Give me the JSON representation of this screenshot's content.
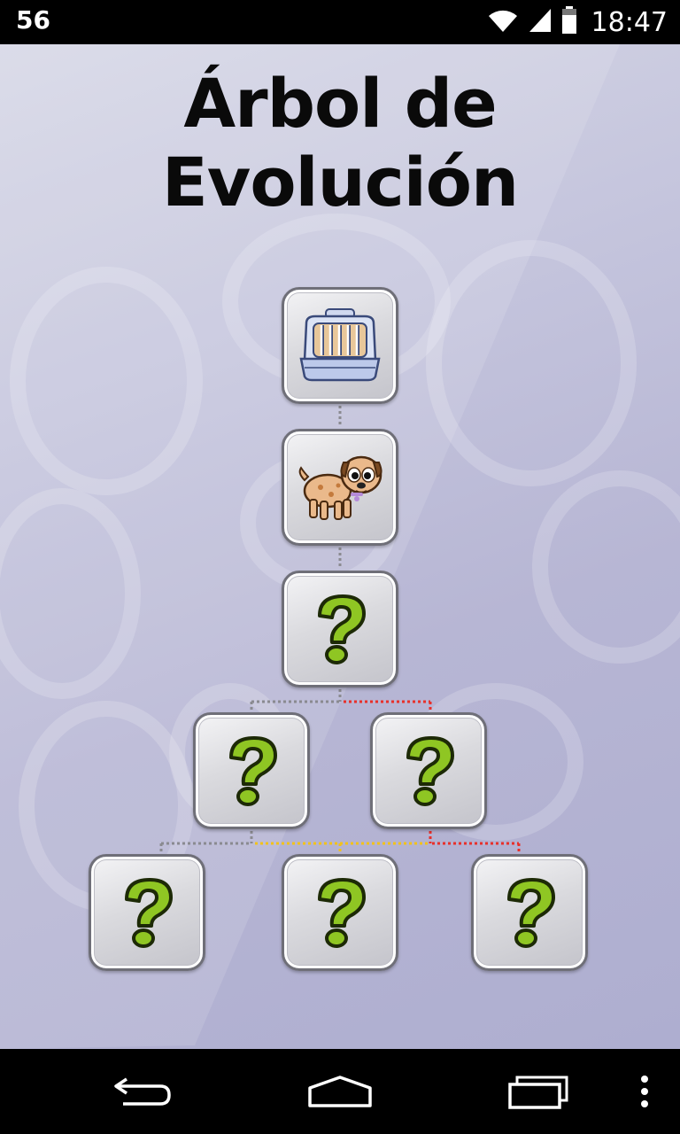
{
  "status_bar": {
    "notification_number": "56",
    "time": "18:47",
    "icons": [
      "wifi-icon",
      "cell-signal-icon",
      "battery-icon"
    ]
  },
  "app": {
    "title": "Árbol de Evolución",
    "tree": [
      {
        "id": "stage-1",
        "icon": "pet-carrier-icon",
        "state": "unlocked"
      },
      {
        "id": "stage-2",
        "icon": "puppy-icon",
        "state": "unlocked"
      },
      {
        "id": "stage-3",
        "icon": "question-mark-icon",
        "state": "locked"
      },
      {
        "id": "stage-4a",
        "icon": "question-mark-icon",
        "state": "locked"
      },
      {
        "id": "stage-4b",
        "icon": "question-mark-icon",
        "state": "locked"
      },
      {
        "id": "stage-5a",
        "icon": "question-mark-icon",
        "state": "locked"
      },
      {
        "id": "stage-5b",
        "icon": "question-mark-icon",
        "state": "locked"
      },
      {
        "id": "stage-5c",
        "icon": "question-mark-icon",
        "state": "locked"
      }
    ],
    "colors": {
      "connector_gray": "#8a8a90",
      "connector_red": "#e8302a",
      "connector_yellow": "#f2c21a",
      "question_green": "#8fc623"
    }
  },
  "nav_bar": {
    "buttons": [
      "back-icon",
      "home-icon",
      "recents-icon",
      "menu-icon"
    ]
  }
}
